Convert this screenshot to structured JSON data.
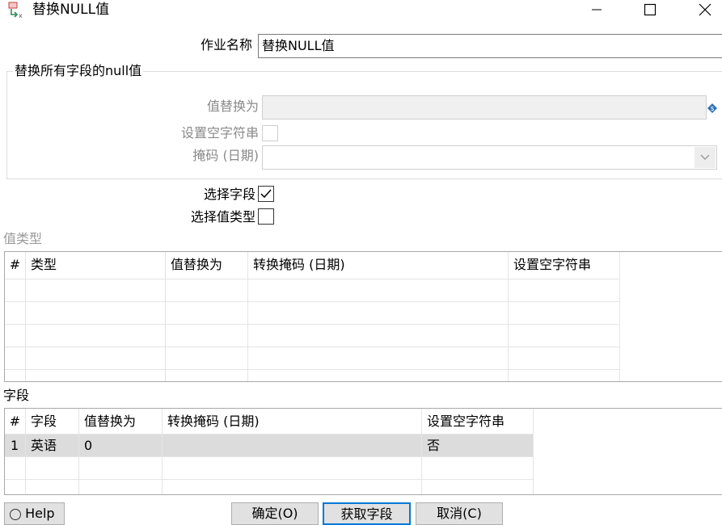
{
  "window": {
    "title": "替换NULL值",
    "icon": "replace-null-icon",
    "controls": [
      "minimize-icon",
      "maximize-icon",
      "close-icon"
    ]
  },
  "form": {
    "step_name_label": "作业名称",
    "step_name_value": "替换NULL值"
  },
  "replace_all": {
    "group_title": "替换所有字段的null值",
    "value_label": "值替换为",
    "value_text": "",
    "set_empty_label": "设置空字符串",
    "set_empty_checked": false,
    "mask_label": "掩码 (日期)",
    "mask_value": ""
  },
  "options": {
    "select_fields_label": "选择字段",
    "select_fields_checked": true,
    "select_value_types_label": "选择值类型",
    "select_value_types_checked": false
  },
  "value_types_table": {
    "title": "值类型",
    "columns": [
      "#",
      "类型",
      "值替换为",
      "转换掩码 (日期)",
      "设置空字符串"
    ],
    "rows": []
  },
  "fields_table": {
    "title": "字段",
    "columns": [
      "#",
      "字段",
      "值替换为",
      "转换掩码 (日期)",
      "设置空字符串"
    ],
    "rows": [
      {
        "num": "1",
        "field": "英语",
        "value": "0",
        "mask": "",
        "set_empty": "否"
      }
    ]
  },
  "buttons": {
    "help": "Help",
    "ok": "确定(O)",
    "get_fields": "获取字段",
    "cancel": "取消(C)"
  },
  "colors": {
    "focus_border": "#0078d7",
    "selected_row": "#dcdcdc",
    "disabled_text": "#8a8a8a"
  }
}
